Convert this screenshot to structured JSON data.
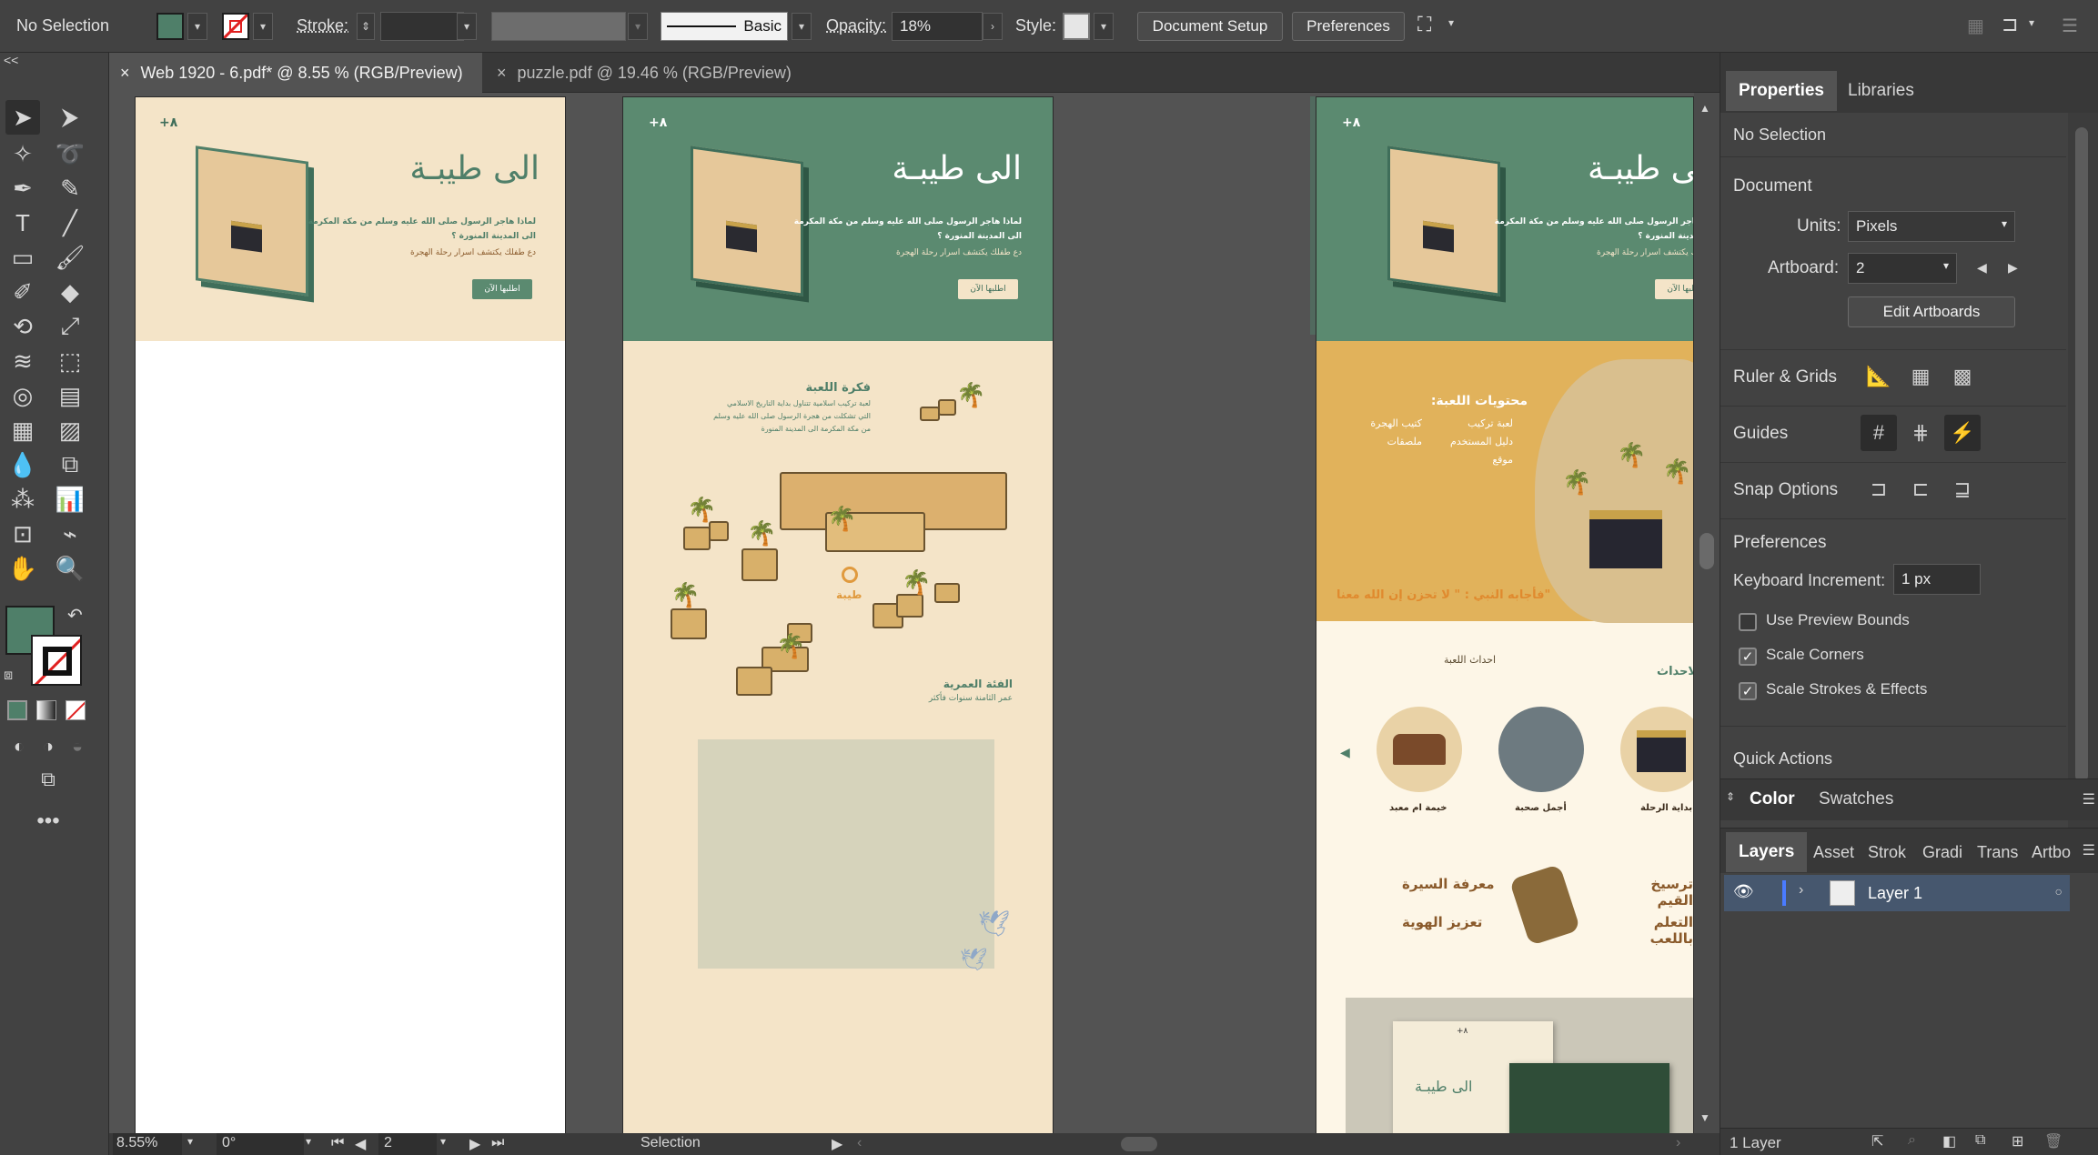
{
  "control_bar": {
    "selection": "No Selection",
    "stroke_label": "Stroke:",
    "brush_label": "Basic",
    "opacity_label": "Opacity:",
    "opacity_value": "18%",
    "style_label": "Style:",
    "document_setup": "Document Setup",
    "preferences": "Preferences",
    "fill_color": "#4f7f69"
  },
  "doc_tabs": [
    {
      "label": "Web 1920 - 6.pdf* @ 8.55 % (RGB/Preview)",
      "close": "×"
    },
    {
      "label": "puzzle.pdf @ 19.46 % (RGB/Preview)",
      "close": "×"
    }
  ],
  "collapse_glyph": "<<",
  "artboards": {
    "age_badge": "٨+",
    "brand": "الى طيبـة",
    "hero_line1": "لماذا هاجر الرسول صلى الله عليه وسلم من مكة المكرمة",
    "hero_line2": "الى المدينة المنورة ؟",
    "hero_line3": "دع طفلك يكتشف اسرار رحلة الهجرة",
    "order_button": "اطلبها الآن",
    "idea_title": "فكرة اللعبة",
    "idea_line1": "لعبة تركيب اسلامية تتناول بداية التاريخ الاسلامي",
    "idea_line2": "التي تشكلت من هجرة الرسول صلى الله عليه وسلم",
    "idea_line3": "من مكة المكرمة الى المدينة المنورة",
    "map_label": "طيبة",
    "age_title": "الفئة العمرية",
    "age_text": "عمر الثامنة سنوات فأكثر",
    "contents_title": "محتويات اللعبة:",
    "contents_col1": [
      "لعبة تركيب",
      "دليل المستخدم",
      "موقع"
    ],
    "contents_col2": [
      "كتيب الهجرة",
      "ملصقات"
    ],
    "quote": "\"فأجابه النبي : \" لا تحزن إن الله معنا",
    "events_title": "احداث اللعبة",
    "events_side": "الاحداث",
    "events": [
      "بداية الرحلة",
      "أجمل صحبة",
      "خيمة ام معبد"
    ],
    "values_right": [
      "ترسيخ القيم",
      "التعلم باللعب"
    ],
    "values_left": [
      "معرفة السيرة",
      "تعزيز الهوية"
    ],
    "colors": {
      "green": "#5b8a70",
      "cream": "#f4e4c8",
      "mustard": "#e1b25b",
      "brown": "#8a5a2b"
    }
  },
  "status_bar": {
    "zoom": "8.55%",
    "rotation": "0°",
    "artboard_num": "2",
    "tool": "Selection"
  },
  "properties_panel": {
    "tabs": [
      "Properties",
      "Libraries"
    ],
    "no_selection": "No Selection",
    "document_label": "Document",
    "units_label": "Units:",
    "units_value": "Pixels",
    "artboard_label": "Artboard:",
    "artboard_value": "2",
    "edit_artboards": "Edit Artboards",
    "ruler_grids": "Ruler & Grids",
    "guides": "Guides",
    "snap_options": "Snap Options",
    "preferences": "Preferences",
    "keyboard_increment_label": "Keyboard Increment:",
    "keyboard_increment_value": "1 px",
    "use_preview_bounds": "Use Preview Bounds",
    "scale_corners": "Scale Corners",
    "scale_strokes": "Scale Strokes & Effects",
    "quick_actions": "Quick Actions",
    "use_preview_bounds_checked": false,
    "scale_corners_checked": true,
    "scale_strokes_checked": true
  },
  "color_panel": {
    "tabs": [
      "Color",
      "Swatches"
    ]
  },
  "layers_panel": {
    "tabs": [
      "Layers",
      "Asset",
      "Strok",
      "Gradi",
      "Trans",
      "Artbo"
    ],
    "layer_name": "Layer 1",
    "footer": "1 Layer"
  }
}
